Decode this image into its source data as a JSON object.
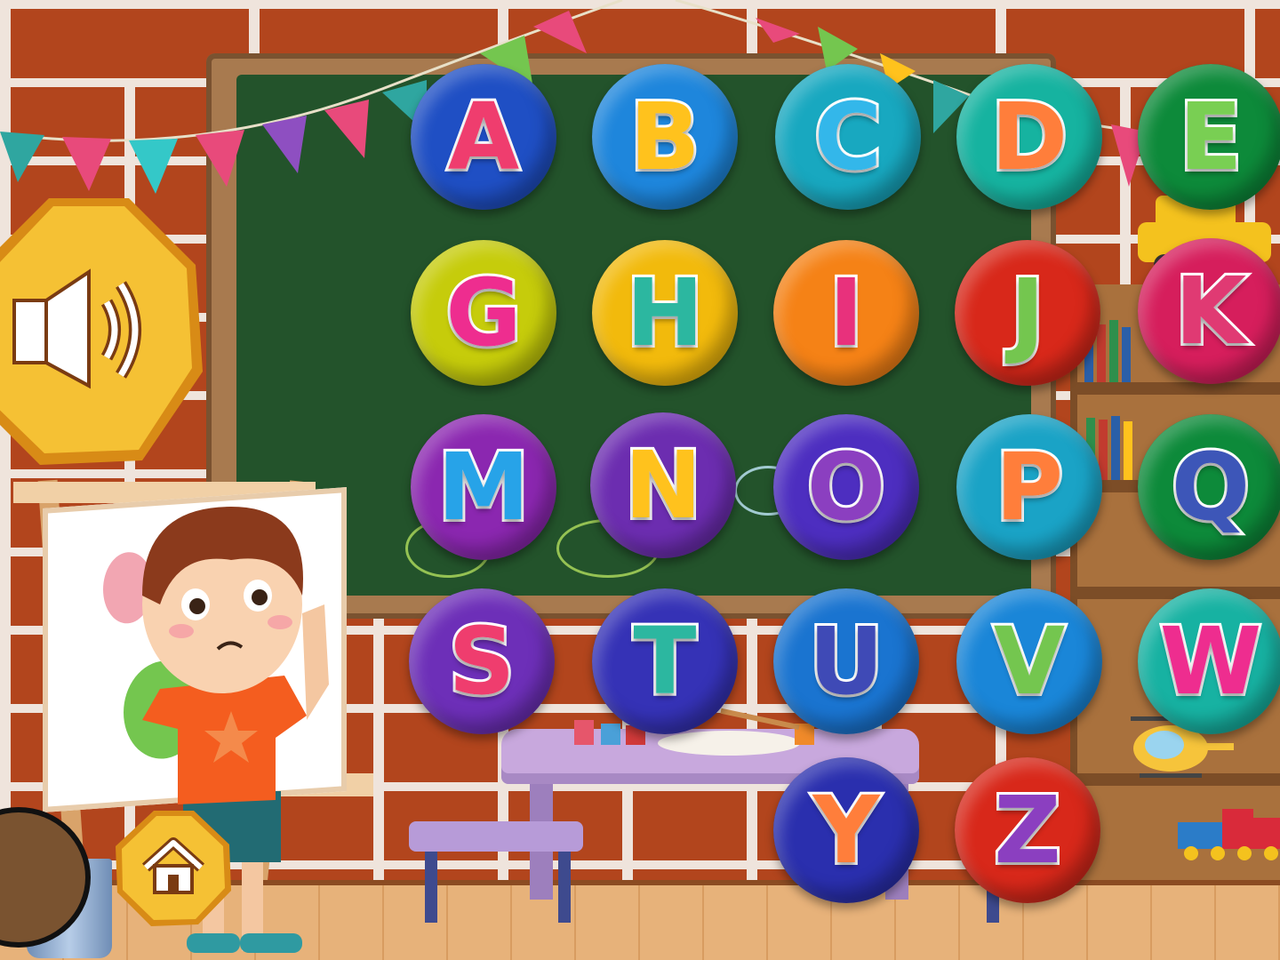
{
  "colors": {
    "wall_brick": "#b2451d",
    "wall_mortar": "#efe4dc",
    "chalkboard": "#23532b",
    "button_gold": "#f5c134",
    "button_gold_edge": "#d88b16"
  },
  "controls": {
    "sound_icon": "speaker-icon",
    "home_icon": "home-icon"
  },
  "letters": [
    {
      "label": "A",
      "bg": "#1f4fc4",
      "fg": "#ef3d6e"
    },
    {
      "label": "B",
      "bg": "#1e86dc",
      "fg": "#ffc21d"
    },
    {
      "label": "C",
      "bg": "#18a8c0",
      "fg": "#33b7ea"
    },
    {
      "label": "D",
      "bg": "#16b3a0",
      "fg": "#ff7e3b"
    },
    {
      "label": "E",
      "bg": "#0d8a3a",
      "fg": "#79cf53"
    },
    {
      "label": "G",
      "bg": "#c6cc0b",
      "fg": "#ee2d8f"
    },
    {
      "label": "H",
      "bg": "#f2ba0c",
      "fg": "#2cb7a0"
    },
    {
      "label": "I",
      "bg": "#f58216",
      "fg": "#e8317c"
    },
    {
      "label": "J",
      "bg": "#d8281a",
      "fg": "#74c64f"
    },
    {
      "label": "K",
      "bg": "#d61e5c",
      "fg": "#e03a73"
    },
    {
      "label": "M",
      "bg": "#8b27b0",
      "fg": "#27a3e8"
    },
    {
      "label": "N",
      "bg": "#6c2db0",
      "fg": "#ffc21d"
    },
    {
      "label": "O",
      "bg": "#4d2ec0",
      "fg": "#8b3fc0"
    },
    {
      "label": "P",
      "bg": "#1aa3c6",
      "fg": "#ff7e3b"
    },
    {
      "label": "Q",
      "bg": "#0d8a3a",
      "fg": "#3d56b8"
    },
    {
      "label": "S",
      "bg": "#6d2fb8",
      "fg": "#ef3d6e"
    },
    {
      "label": "T",
      "bg": "#3532b6",
      "fg": "#2cb7a0"
    },
    {
      "label": "U",
      "bg": "#1a74d0",
      "fg": "#3f4ab6"
    },
    {
      "label": "V",
      "bg": "#1a86d8",
      "fg": "#74c64f"
    },
    {
      "label": "W",
      "bg": "#17b2a2",
      "fg": "#ee2d8f"
    },
    {
      "label": "Y",
      "bg": "#2a2fae",
      "fg": "#ff7e3b"
    },
    {
      "label": "Z",
      "bg": "#d8281a",
      "fg": "#8b3fc0"
    }
  ]
}
